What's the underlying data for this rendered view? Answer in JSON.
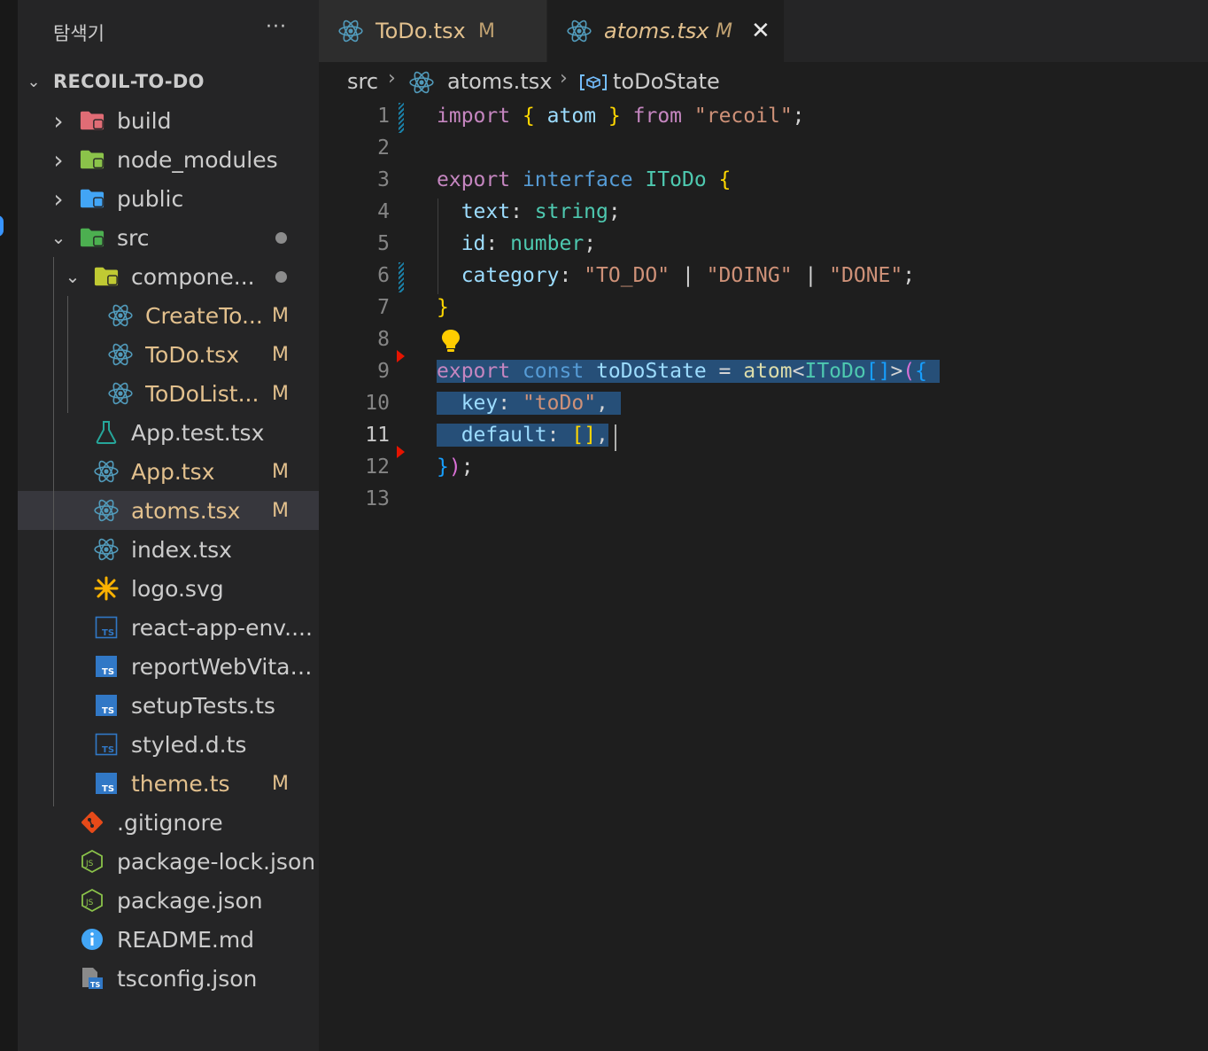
{
  "sidebar": {
    "title": "탐색기",
    "more": "···",
    "root": "RECOIL-TO-DO",
    "items": [
      {
        "label": "build",
        "icon": "folder-build-icon",
        "color": "#e06c75",
        "status": ""
      },
      {
        "label": "node_modules",
        "icon": "folder-node-icon",
        "color": "#8bc34a",
        "status": ""
      },
      {
        "label": "public",
        "icon": "folder-public-icon",
        "color": "#42a5f5",
        "status": ""
      },
      {
        "label": "src",
        "icon": "folder-src-icon",
        "color": "#4caf50",
        "status": "●"
      },
      {
        "label": "compone...",
        "icon": "folder-components-icon",
        "color": "#c0ca33",
        "status": "●"
      },
      {
        "label": "CreateTo...",
        "icon": "react-icon",
        "color": "#519aba",
        "status": "M"
      },
      {
        "label": "ToDo.tsx",
        "icon": "react-icon",
        "color": "#519aba",
        "status": "M"
      },
      {
        "label": "ToDoList...",
        "icon": "react-icon",
        "color": "#519aba",
        "status": "M"
      },
      {
        "label": "App.test.tsx",
        "icon": "test-flask-icon",
        "color": "#26a69a",
        "status": ""
      },
      {
        "label": "App.tsx",
        "icon": "react-icon",
        "color": "#519aba",
        "status": "M"
      },
      {
        "label": "atoms.tsx",
        "icon": "react-icon",
        "color": "#519aba",
        "status": "M"
      },
      {
        "label": "index.tsx",
        "icon": "react-icon",
        "color": "#519aba",
        "status": ""
      },
      {
        "label": "logo.svg",
        "icon": "svg-asterisk-icon",
        "color": "#ffb300",
        "status": ""
      },
      {
        "label": "react-app-env....",
        "icon": "typescript-def-icon",
        "color": "#3178c6",
        "status": ""
      },
      {
        "label": "reportWebVital...",
        "icon": "typescript-icon",
        "color": "#3178c6",
        "status": ""
      },
      {
        "label": "setupTests.ts",
        "icon": "typescript-icon",
        "color": "#3178c6",
        "status": ""
      },
      {
        "label": "styled.d.ts",
        "icon": "typescript-def-icon",
        "color": "#3178c6",
        "status": ""
      },
      {
        "label": "theme.ts",
        "icon": "typescript-icon",
        "color": "#3178c6",
        "status": "M"
      },
      {
        "label": ".gitignore",
        "icon": "git-icon",
        "color": "#e64a19",
        "status": ""
      },
      {
        "label": "package-lock.json",
        "icon": "nodejs-icon",
        "color": "#8bc34a",
        "status": ""
      },
      {
        "label": "package.json",
        "icon": "nodejs-icon",
        "color": "#8bc34a",
        "status": ""
      },
      {
        "label": "README.md",
        "icon": "info-icon",
        "color": "#42a5f5",
        "status": ""
      },
      {
        "label": "tsconfig.json",
        "icon": "tsconfig-icon",
        "color": "#3178c6",
        "status": ""
      }
    ]
  },
  "tabs": [
    {
      "label": "ToDo.tsx",
      "badge": "M",
      "active": false
    },
    {
      "label": "atoms.tsx",
      "badge": "M",
      "active": true,
      "close": "✕"
    }
  ],
  "breadcrumb": {
    "folder": "src",
    "file": "atoms.tsx",
    "symbol": "toDoState"
  },
  "code": {
    "line_numbers": [
      "1",
      "2",
      "3",
      "4",
      "5",
      "6",
      "7",
      "8",
      "9",
      "10",
      "11",
      "12",
      "13"
    ],
    "current_line": "11"
  }
}
